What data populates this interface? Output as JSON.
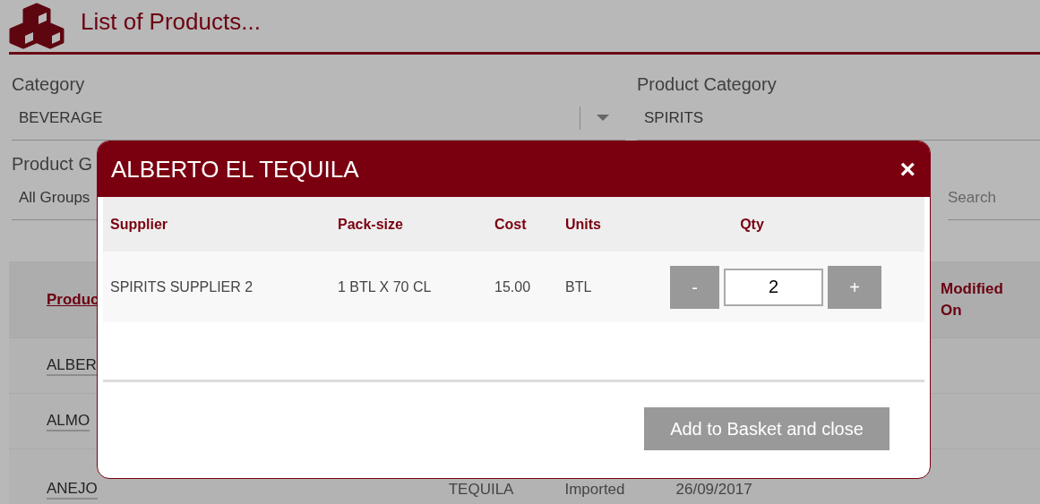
{
  "page": {
    "title": "List of Products..."
  },
  "filters": [
    {
      "label": "Category",
      "value": "BEVERAGE",
      "dropdown": true
    },
    {
      "label": "Product Category",
      "value": "SPIRITS",
      "dropdown": false
    },
    {
      "label": "Product G",
      "value": "All Groups"
    }
  ],
  "search": {
    "placeholder": "Search"
  },
  "table": {
    "columns": [
      "Produc",
      "Modified On"
    ],
    "rows": [
      {
        "product": "ALBER"
      },
      {
        "product": "ALMO"
      },
      {
        "product": "ANEJO",
        "column_2": "TEQUILA",
        "column_3": "Imported",
        "column_4": "26/09/2017"
      }
    ]
  },
  "dialog": {
    "title": "ALBERTO EL TEQUILA",
    "close": "×",
    "columns": [
      "Supplier",
      "Pack-size",
      "Cost",
      "Units",
      "Qty"
    ],
    "rows": [
      {
        "supplier": "SPIRITS SUPPLIER 2",
        "pack_size": "1 BTL X 70 CL",
        "cost": "15.00",
        "units": "BTL",
        "qty": "2",
        "minus": "-",
        "plus": "+"
      }
    ],
    "button": "Add to Basket and close"
  }
}
